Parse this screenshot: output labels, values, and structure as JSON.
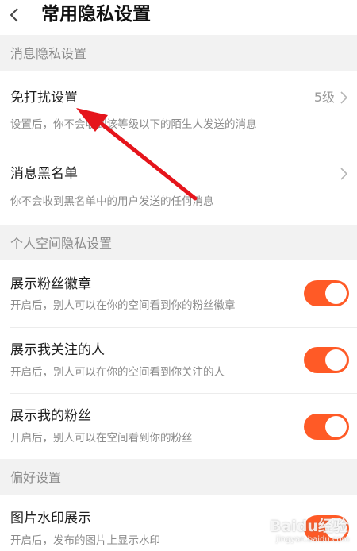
{
  "header": {
    "title": "常用隐私设置",
    "back_icon": "chevron-left-icon"
  },
  "sections": {
    "message": {
      "title": "消息隐私设置",
      "dnd": {
        "title": "免打扰设置",
        "value": "5级",
        "subtitle": "设置后，你不会收到该等级以下的陌生人发送的消息"
      },
      "blacklist": {
        "title": "消息黑名单",
        "subtitle": "你不会收到黑名单中的用户发送的任何消息"
      }
    },
    "space": {
      "title": "个人空间隐私设置",
      "badge": {
        "title": "展示粉丝徽章",
        "subtitle": "开启后，别人可以在你的空间看到你的粉丝徽章",
        "on": true
      },
      "following": {
        "title": "展示我关注的人",
        "subtitle": "开启后，别人可以在你的空间看到你关注的人",
        "on": true
      },
      "fans": {
        "title": "展示我的粉丝",
        "subtitle": "开启后，别人可以在空间看到你的粉丝",
        "on": true
      }
    },
    "preference": {
      "title": "偏好设置",
      "watermark": {
        "title": "图片水印展示",
        "subtitle": "开启后，发布的图片上显示水印",
        "on": true
      }
    }
  },
  "colors": {
    "accent": "#ff5a26",
    "annotation_arrow": "#e5141b",
    "background": "#f2f2f2"
  },
  "overlay": {
    "watermark_brand": "Baidu经验",
    "watermark_url": "jingyan.baidu.com"
  }
}
